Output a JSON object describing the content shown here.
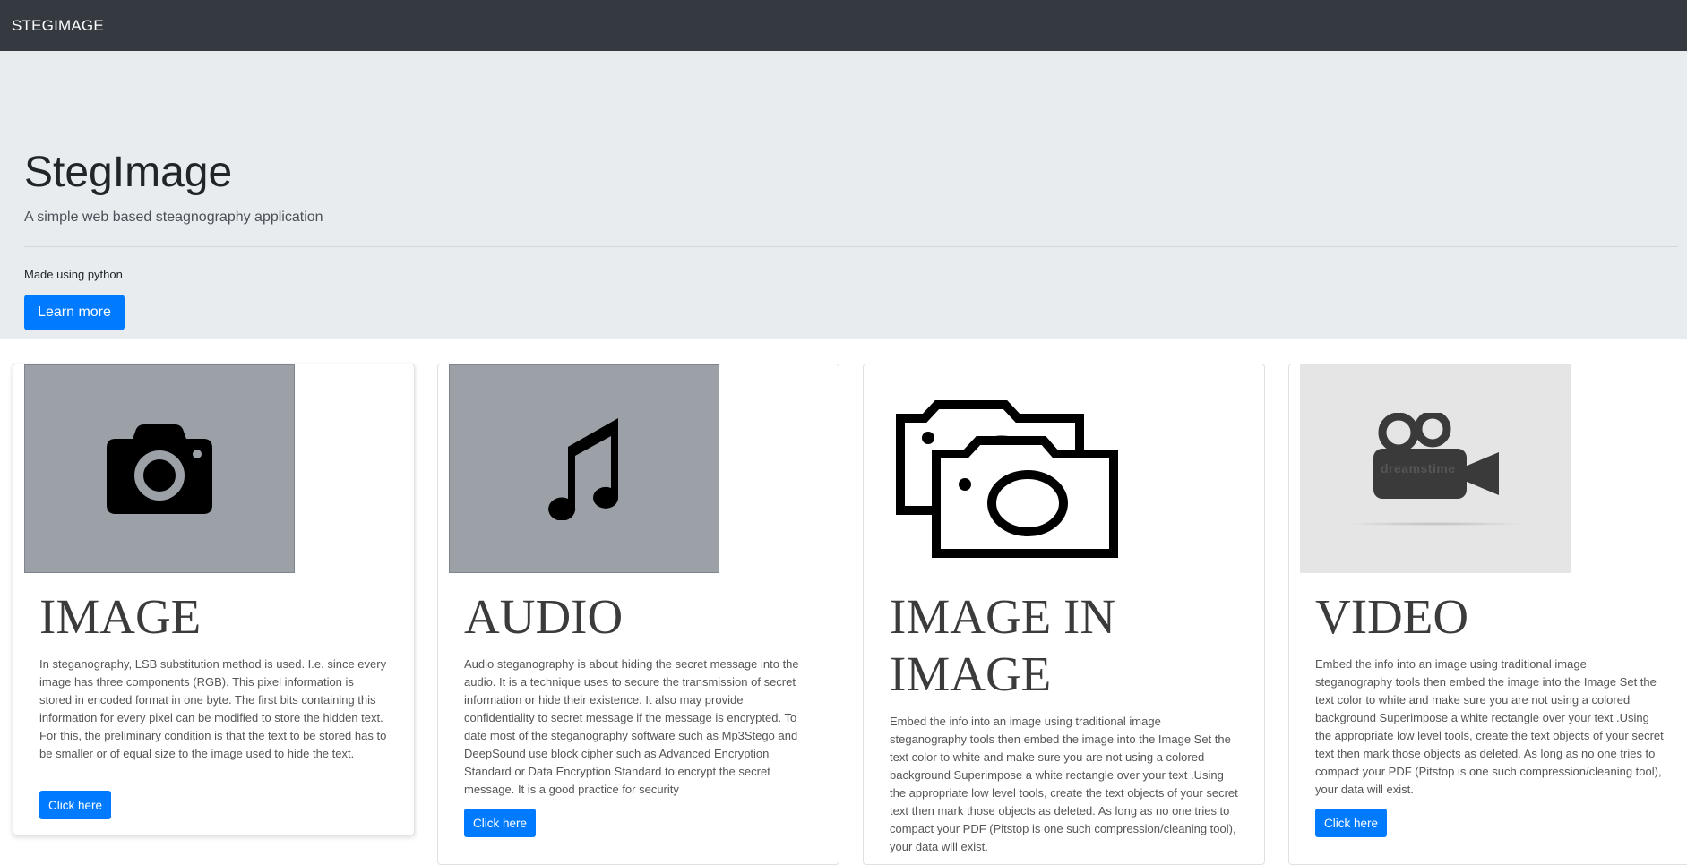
{
  "navbar": {
    "brand": "STEGIMAGE"
  },
  "jumbotron": {
    "title": "StegImage",
    "lead": "A simple web based steagnography application",
    "text": "Made using python",
    "button_label": "Learn more"
  },
  "cards": [
    {
      "title": "IMAGE",
      "icon": "camera-icon",
      "text": "In steganography, LSB substitution method is used. I.e. since every image has three components (RGB). This pixel information is stored in encoded format in one byte. The first bits containing this information for every pixel can be modified to store the hidden text. For this, the preliminary condition is that the text to be stored has to be smaller or of equal size to the image used to hide the text.",
      "button_label": "Click here"
    },
    {
      "title": "AUDIO",
      "icon": "music-note-icon",
      "text": "Audio steganography is about hiding the secret message into the audio. It is a technique uses to secure the transmission of secret information or hide their existence. It also may provide confidentiality to secret message if the message is encrypted. To date most of the steganography software such as Mp3Stego and DeepSound use block cipher such as Advanced Encryption Standard or Data Encryption Standard to encrypt the secret message. It is a good practice for security",
      "button_label": "Click here"
    },
    {
      "title": "IMAGE IN IMAGE",
      "icon": "double-camera-icon",
      "text": "Embed the info into an image using traditional image steganography tools then embed the image into the Image Set the text color to white and make sure you are not using a colored background Superimpose a white rectangle over your text .Using the appropriate low level tools, create the text objects of your secret text then mark those objects as deleted. As long as no one tries to compact your PDF (Pitstop is one such compression/cleaning tool), your data will exist.",
      "button_label": "Click here"
    },
    {
      "title": "VIDEO",
      "icon": "video-camera-icon",
      "watermark": "dreamstime",
      "text": "Embed the info into an image using traditional image steganography tools then embed the image into the Image Set the text color to white and make sure you are not using a colored background Superimpose a white rectangle over your text .Using the appropriate low level tools, create the text objects of your secret text then mark those objects as deleted. As long as no one tries to compact your PDF (Pitstop is one such compression/cleaning tool), your data will exist.",
      "button_label": "Click here"
    }
  ]
}
